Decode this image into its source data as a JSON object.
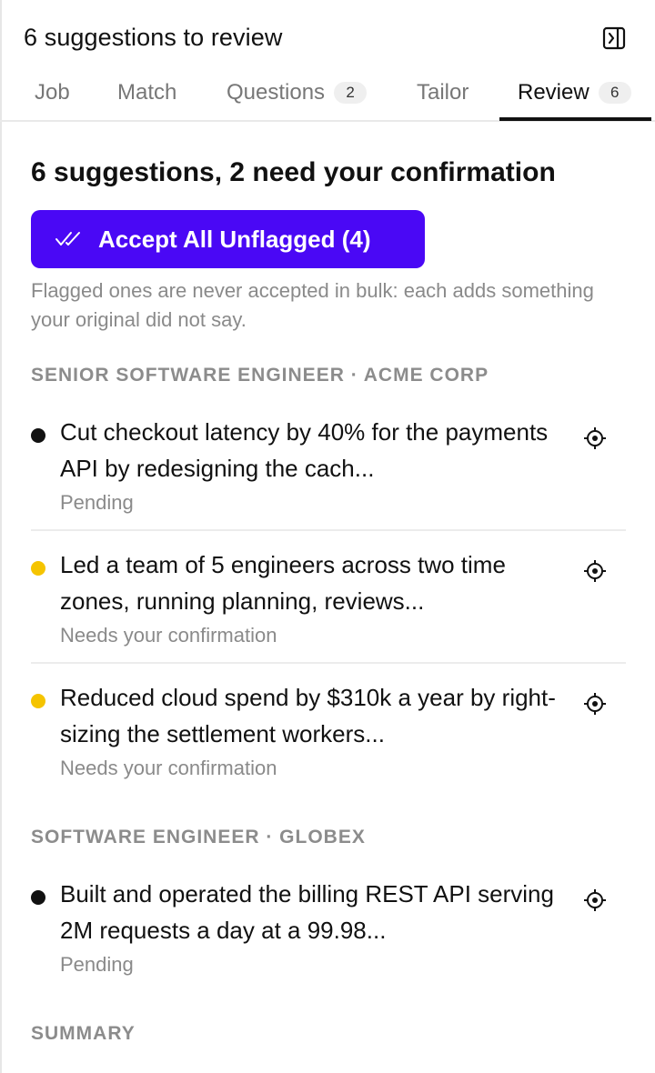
{
  "header": {
    "title": "6 suggestions to review",
    "collapse_icon": "sidebar-collapse-icon"
  },
  "tabs": [
    {
      "label": "Job"
    },
    {
      "label": "Match"
    },
    {
      "label": "Questions",
      "badge": "2"
    },
    {
      "label": "Tailor"
    },
    {
      "label": "Review",
      "badge": "6",
      "active": true
    }
  ],
  "summary": {
    "title": "6 suggestions, 2 need your confirmation",
    "accept_label": "Accept All Unflagged (4)",
    "accept_icon": "double-check-icon",
    "note": "Flagged ones are never accepted in bulk: each adds something your original did not say."
  },
  "sections": [
    {
      "label": "SENIOR SOFTWARE ENGINEER · ACME CORP",
      "items": [
        {
          "text": "Cut checkout latency by 40% for the payments API by redesigning the cach...",
          "status": "Pending",
          "flag": "pending"
        },
        {
          "text": "Led a team of 5 engineers across two time zones, running planning, reviews...",
          "status": "Needs your confirmation",
          "flag": "flagged"
        },
        {
          "text": "Reduced cloud spend by $310k a year by right-sizing the settlement workers...",
          "status": "Needs your confirmation",
          "flag": "flagged"
        }
      ]
    },
    {
      "label": "SOFTWARE ENGINEER · GLOBEX",
      "items": [
        {
          "text": "Built and operated the billing REST API serving 2M requests a day at a 99.98...",
          "status": "Pending",
          "flag": "pending"
        }
      ]
    },
    {
      "label": "SUMMARY",
      "items": []
    }
  ],
  "colors": {
    "accent": "#4a08f5",
    "pending_dot": "#111111",
    "flagged_dot": "#f5c400",
    "muted_text": "#8a8a8a"
  },
  "icons": {
    "item_action": "locate-crosshair-icon"
  }
}
